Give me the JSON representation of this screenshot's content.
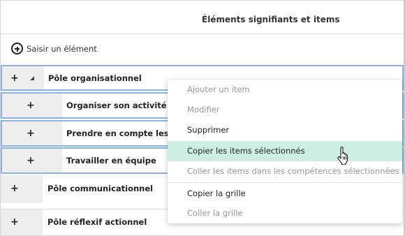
{
  "header": {
    "title": "Éléments signifiants et items"
  },
  "toolbar": {
    "add_label": "Saisir un élément"
  },
  "rows": [
    {
      "plus": "+",
      "label": "Pôle organisationnel"
    },
    {
      "plus": "+",
      "label": "Organiser son activité"
    },
    {
      "plus": "+",
      "label": "Prendre en compte les co"
    },
    {
      "plus": "+",
      "label": "Travailler en équipe"
    },
    {
      "plus": "+",
      "label": "Pôle communicationnel"
    },
    {
      "plus": "+",
      "label": "Pôle réflexif actionnel"
    }
  ],
  "context_menu": {
    "items": [
      {
        "label": "Ajouter un item",
        "enabled": false
      },
      {
        "label": "Modifier",
        "enabled": false
      },
      {
        "label": "Supprimer",
        "enabled": true
      },
      {
        "label": "Copier les items sélectionnés",
        "enabled": true,
        "hovered": true
      },
      {
        "label": "Coller les items dans les compétences sélectionnées",
        "enabled": false
      },
      {
        "label": "Copier la grille",
        "enabled": true
      },
      {
        "label": "Coller la grille",
        "enabled": false
      }
    ]
  },
  "colors": {
    "selection_border": "#8eb2de",
    "menu_hover": "#cdeee1",
    "disabled_text": "#999999",
    "plus_column": "#eeeeee"
  }
}
